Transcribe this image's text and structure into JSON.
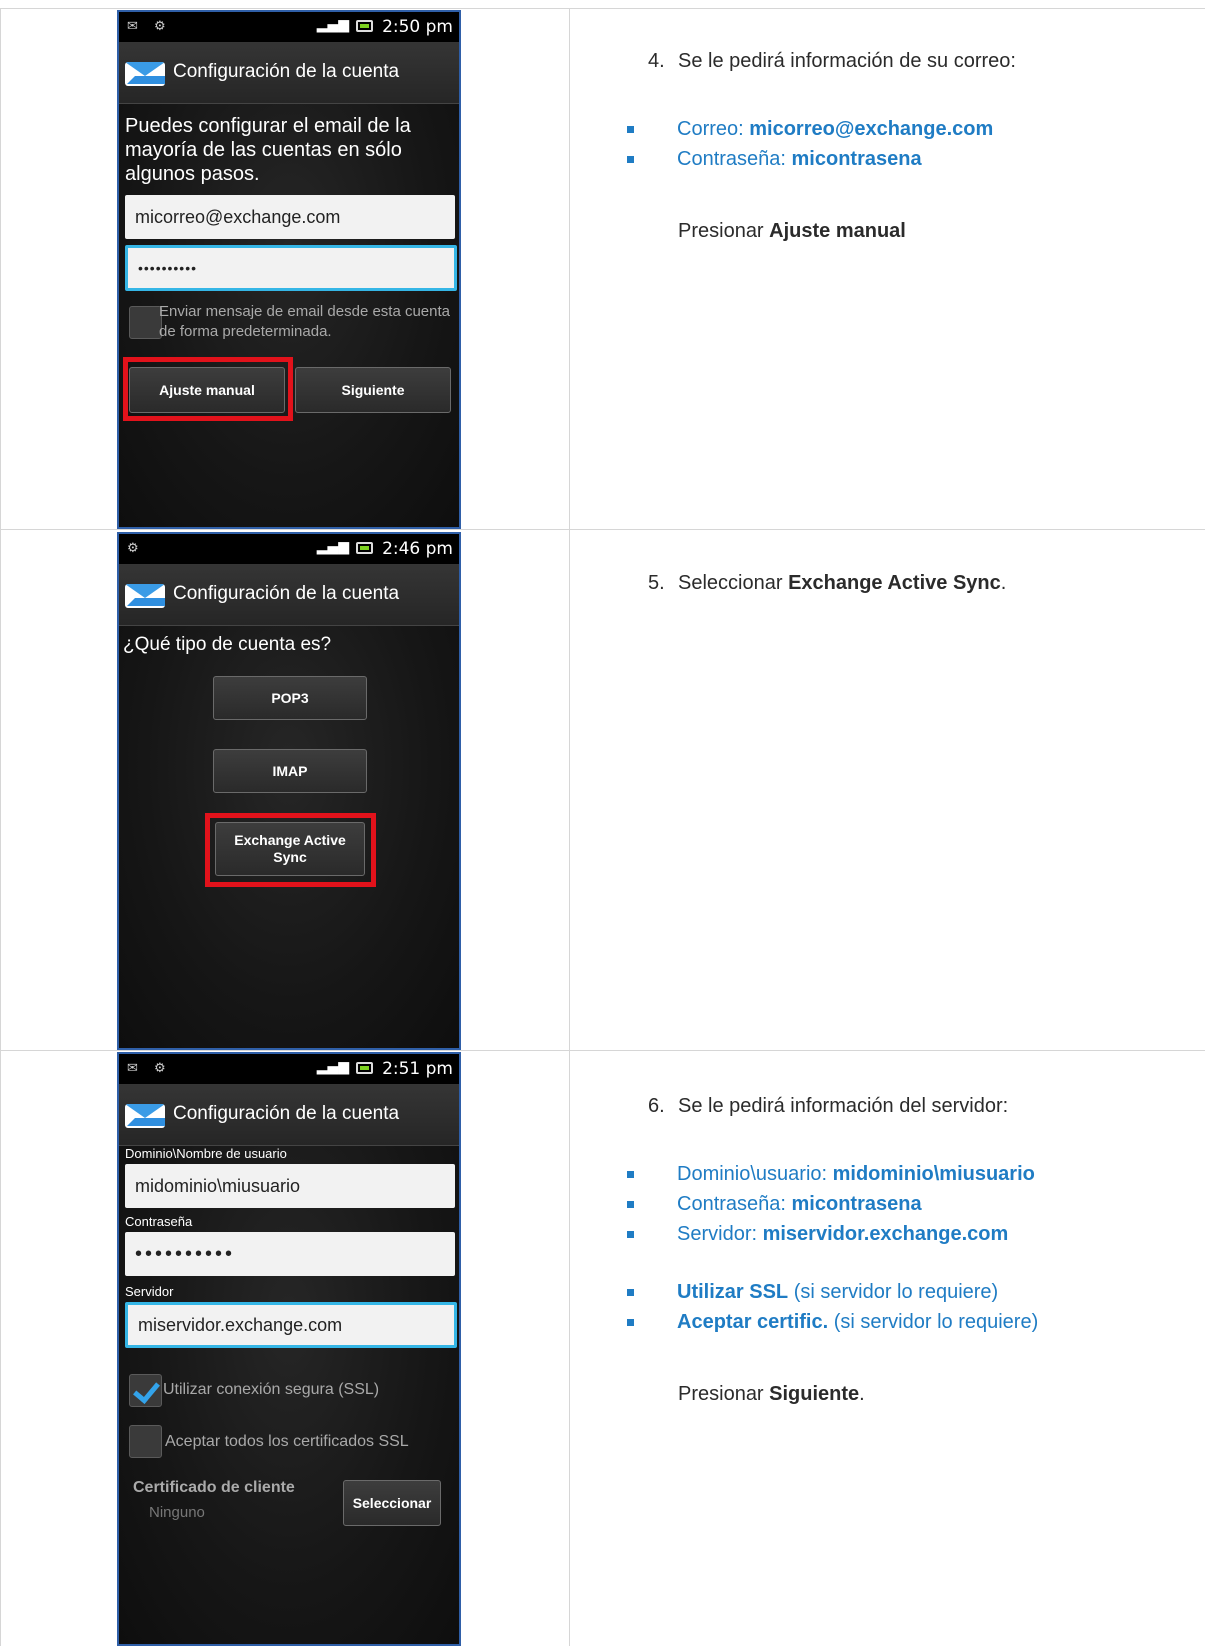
{
  "step4": {
    "status_time": "2:50 pm",
    "status_signal": "3G",
    "screen_title": "Configuración de la cuenta",
    "intro": "Puedes configurar el email de la mayoría de las cuentas en sólo algunos pasos.",
    "email_value": "micorreo@exchange.com",
    "password_value": "••••••••••",
    "default_label": "Enviar mensaje de email desde esta cuenta de forma predeterminada.",
    "manual_button": "Ajuste manual",
    "next_button": "Siguiente",
    "instr_num": "4.",
    "instr_text": "Se le pedirá información de su correo:",
    "bullets": [
      {
        "label": "Correo: ",
        "value": "micorreo@exchange.com",
        "suffix": ""
      },
      {
        "label": "Contraseña: ",
        "value": "micontrasena",
        "suffix": ""
      }
    ],
    "press_prefix": "Presionar ",
    "press_bold": "Ajuste manual",
    "press_suffix": ""
  },
  "step5": {
    "status_time": "2:46 pm",
    "status_signal": "3G",
    "screen_title": "Configuración de la cuenta",
    "question": "¿Qué tipo de cuenta es?",
    "options": [
      "POP3",
      "IMAP",
      "Exchange Active Sync"
    ],
    "instr_num": "5.",
    "instr_prefix": "Seleccionar ",
    "instr_bold": "Exchange Active Sync",
    "instr_suffix": "."
  },
  "step6": {
    "status_time": "2:51 pm",
    "status_signal": "3G",
    "screen_title": "Configuración de la cuenta",
    "user_label": "Dominio\\Nombre de usuario",
    "user_value": "midominio\\miusuario",
    "pass_label": "Contraseña",
    "pass_value": "••••••••••",
    "server_label": "Servidor",
    "server_value": "miservidor.exchange.com",
    "ssl_label": "Utilizar conexión segura (SSL)",
    "cert_label": "Aceptar todos los certificados SSL",
    "client_cert_label": "Certificado de cliente",
    "client_cert_value": "Ninguno",
    "select_button": "Seleccionar",
    "instr_num": "6.",
    "instr_text": "Se le pedirá información del servidor:",
    "bullets": [
      {
        "label": "Dominio\\usuario: ",
        "value": "midominio\\miusuario",
        "suffix": ""
      },
      {
        "label": "Contraseña: ",
        "value": "micontrasena",
        "suffix": ""
      },
      {
        "label": "Servidor: ",
        "value": "miservidor.exchange.com",
        "suffix": ""
      }
    ],
    "bullets2": [
      {
        "label": "",
        "value": "Utilizar SSL",
        "suffix": " (si servidor lo requiere)"
      },
      {
        "label": "",
        "value": "Aceptar certific.",
        "suffix": " (si servidor lo requiere)"
      }
    ],
    "press_prefix": "Presionar ",
    "press_bold": "Siguiente",
    "press_suffix": "."
  },
  "colors": {
    "accent_blue": "#1f7cc4",
    "highlight_red": "#e2121b",
    "focus_cyan": "#35b6e6"
  }
}
